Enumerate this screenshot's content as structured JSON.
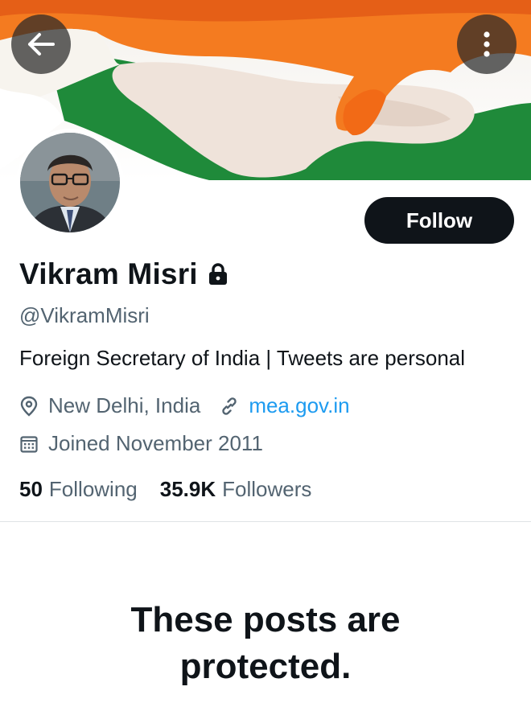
{
  "header": {
    "back_icon": "arrow-left-icon",
    "more_icon": "more-vertical-icon"
  },
  "profile": {
    "display_name": "Vikram Misri",
    "protected_icon": "lock-icon",
    "handle": "@VikramMisri",
    "bio": "Foreign Secretary of India | Tweets are personal",
    "location": "New Delhi, India",
    "website": "mea.gov.in",
    "joined": "Joined November 2011",
    "follow_label": "Follow"
  },
  "stats": {
    "following_count": "50",
    "following_label": "Following",
    "followers_count": "35.9K",
    "followers_label": "Followers"
  },
  "protected_message": {
    "line1": "These posts are",
    "line2": "protected."
  },
  "colors": {
    "saffron": "#f47b20",
    "green": "#1f8a3a",
    "link": "#1d9bf0",
    "follow_bg": "#0f1419"
  }
}
